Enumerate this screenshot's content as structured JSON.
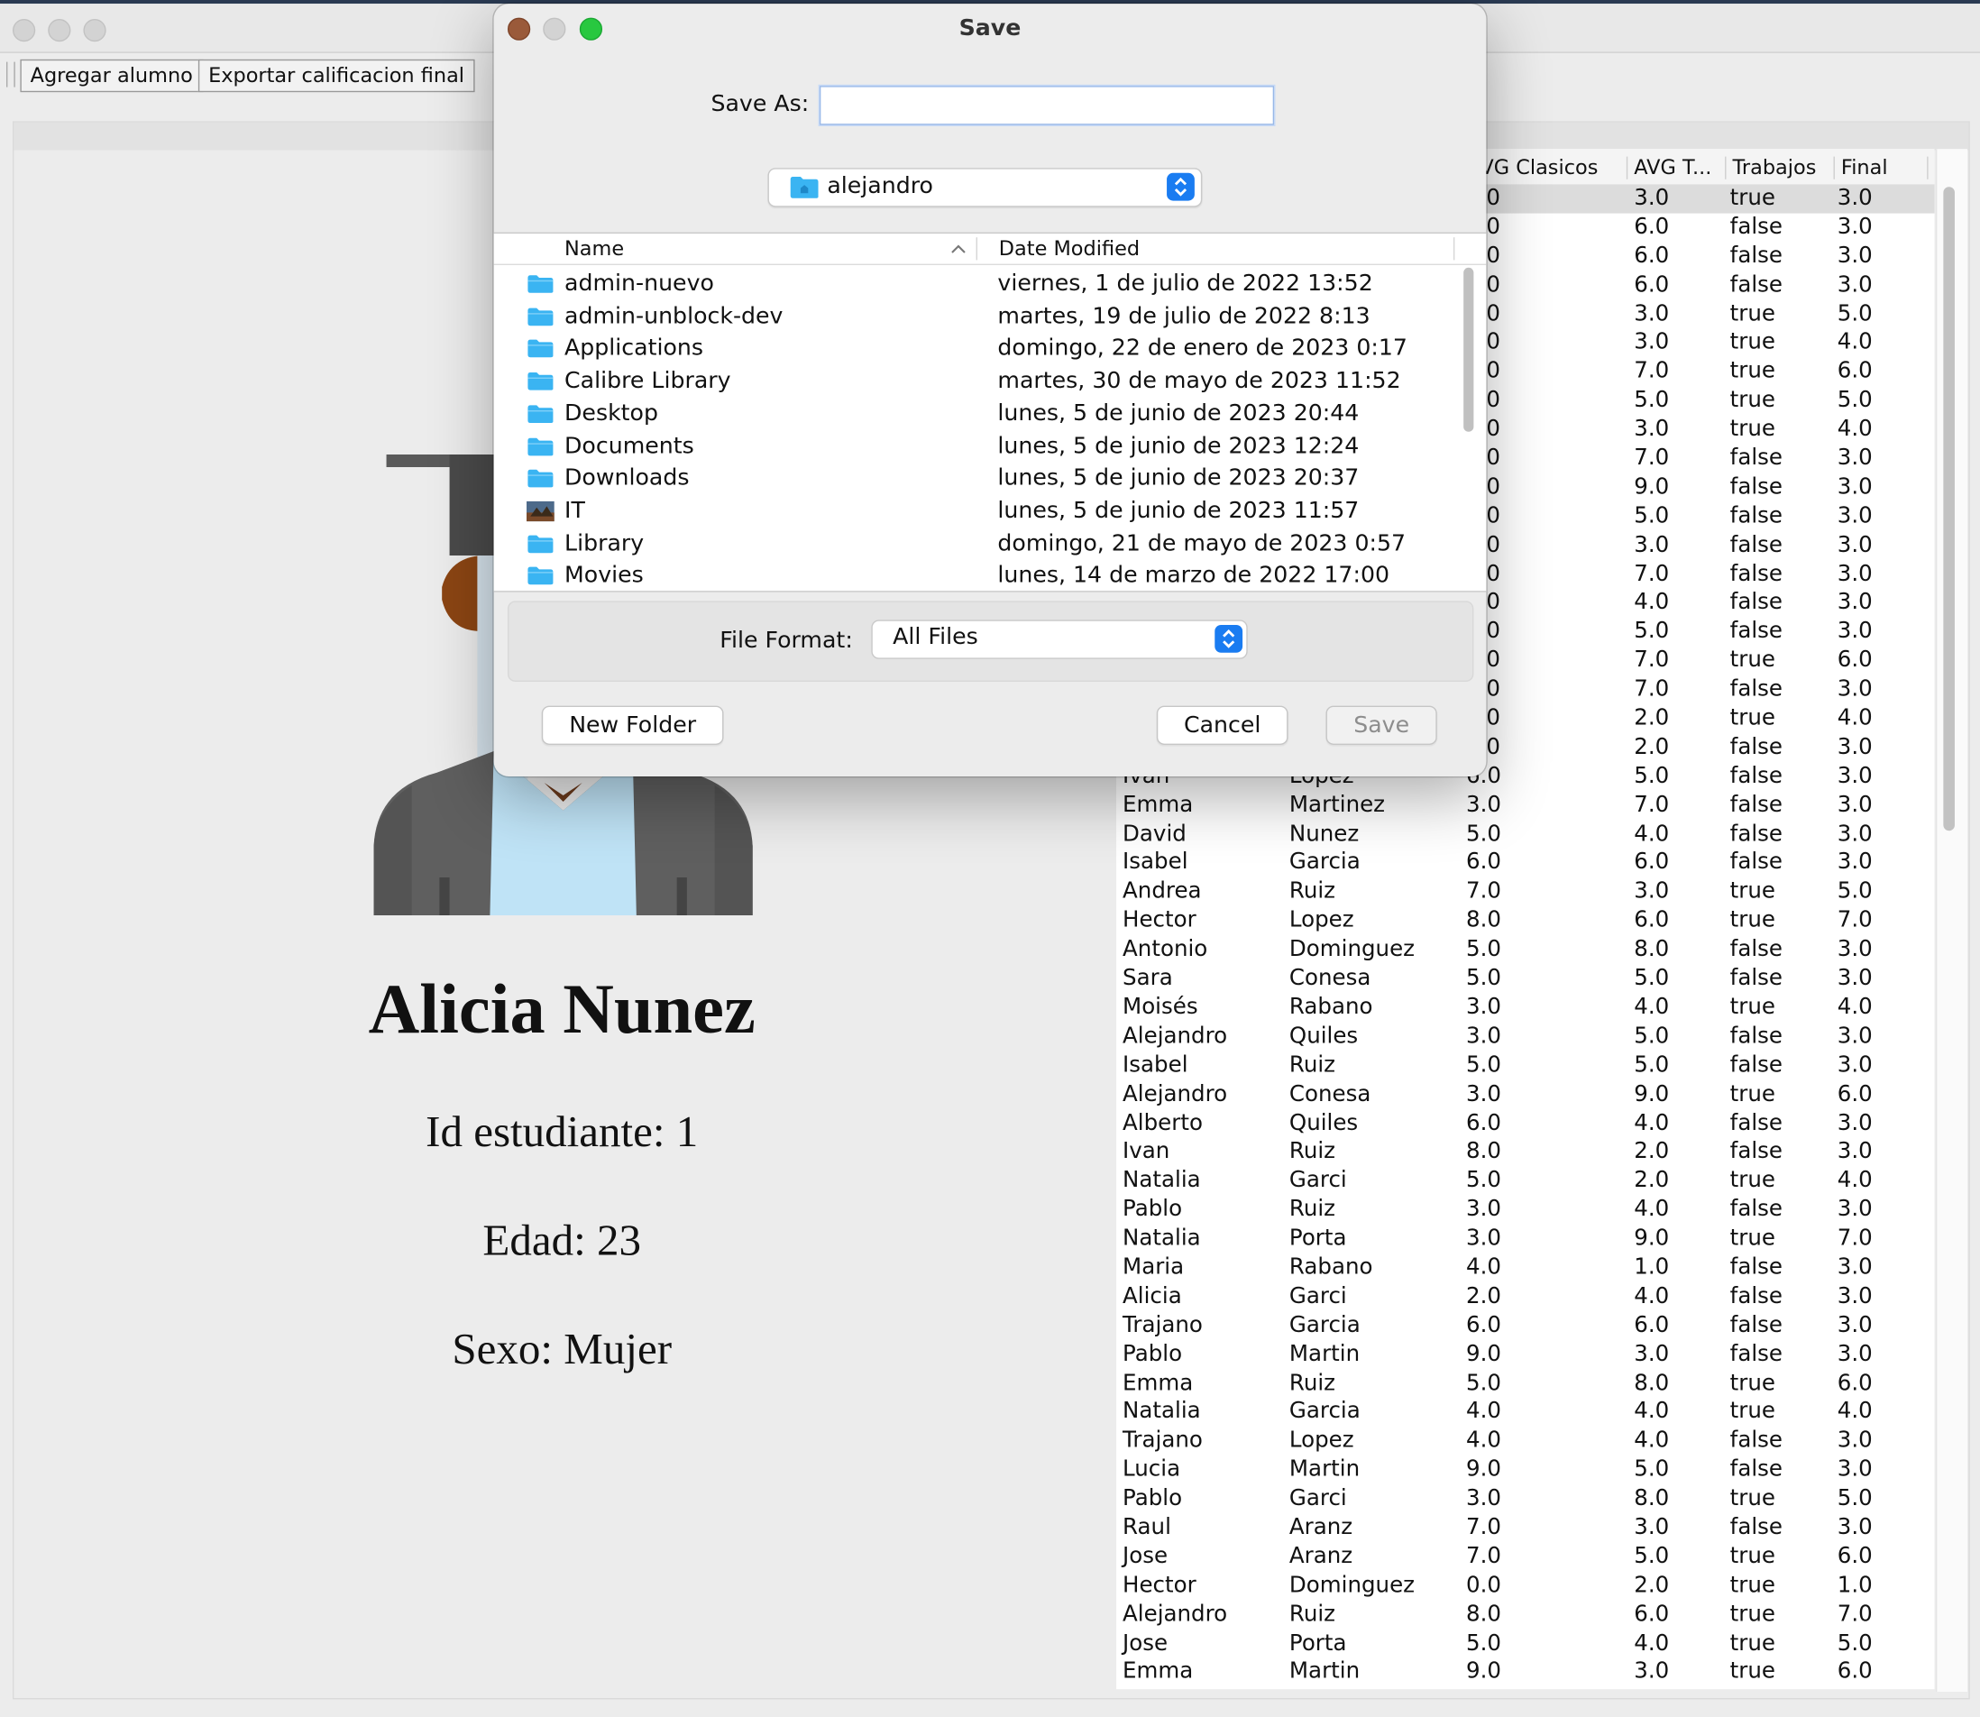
{
  "toolbar": {
    "add_student": "Agregar alumno",
    "export_final": "Exportar calificacion final"
  },
  "student": {
    "name": "Alicia Nunez",
    "id_line": "Id estudiante: 1",
    "age_line": "Edad: 23",
    "sex_line": "Sexo: Mujer"
  },
  "table": {
    "headers": [
      "VG Clasicos",
      "AVG T...",
      "Trabajos",
      "Final"
    ],
    "top_rows": [
      [
        "0",
        "3.0",
        "true",
        "3.0"
      ],
      [
        "0",
        "6.0",
        "false",
        "3.0"
      ],
      [
        "0",
        "6.0",
        "false",
        "3.0"
      ],
      [
        "0",
        "6.0",
        "false",
        "3.0"
      ],
      [
        "0",
        "3.0",
        "true",
        "5.0"
      ],
      [
        "0",
        "3.0",
        "true",
        "4.0"
      ],
      [
        "0",
        "7.0",
        "true",
        "6.0"
      ],
      [
        "0",
        "5.0",
        "true",
        "5.0"
      ],
      [
        "0",
        "3.0",
        "true",
        "4.0"
      ],
      [
        "0",
        "7.0",
        "false",
        "3.0"
      ],
      [
        "0",
        "9.0",
        "false",
        "3.0"
      ],
      [
        "0",
        "5.0",
        "false",
        "3.0"
      ],
      [
        "0",
        "3.0",
        "false",
        "3.0"
      ],
      [
        "0",
        "7.0",
        "false",
        "3.0"
      ],
      [
        "0",
        "4.0",
        "false",
        "3.0"
      ],
      [
        "0",
        "5.0",
        "false",
        "3.0"
      ],
      [
        "0",
        "7.0",
        "true",
        "6.0"
      ],
      [
        "0",
        "7.0",
        "false",
        "3.0"
      ],
      [
        "0",
        "2.0",
        "true",
        "4.0"
      ],
      [
        "0",
        "2.0",
        "false",
        "3.0"
      ]
    ],
    "rows": [
      [
        "Ivan",
        "Lopez",
        "6.0",
        "5.0",
        "false",
        "3.0"
      ],
      [
        "Emma",
        "Martinez",
        "3.0",
        "7.0",
        "false",
        "3.0"
      ],
      [
        "David",
        "Nunez",
        "5.0",
        "4.0",
        "false",
        "3.0"
      ],
      [
        "Isabel",
        "Garcia",
        "6.0",
        "6.0",
        "false",
        "3.0"
      ],
      [
        "Andrea",
        "Ruiz",
        "7.0",
        "3.0",
        "true",
        "5.0"
      ],
      [
        "Hector",
        "Lopez",
        "8.0",
        "6.0",
        "true",
        "7.0"
      ],
      [
        "Antonio",
        "Dominguez",
        "5.0",
        "8.0",
        "false",
        "3.0"
      ],
      [
        "Sara",
        "Conesa",
        "5.0",
        "5.0",
        "false",
        "3.0"
      ],
      [
        "Moisés",
        "Rabano",
        "3.0",
        "4.0",
        "true",
        "4.0"
      ],
      [
        "Alejandro",
        "Quiles",
        "3.0",
        "5.0",
        "false",
        "3.0"
      ],
      [
        "Isabel",
        "Ruiz",
        "5.0",
        "5.0",
        "false",
        "3.0"
      ],
      [
        "Alejandro",
        "Conesa",
        "3.0",
        "9.0",
        "true",
        "6.0"
      ],
      [
        "Alberto",
        "Quiles",
        "6.0",
        "4.0",
        "false",
        "3.0"
      ],
      [
        "Ivan",
        "Ruiz",
        "8.0",
        "2.0",
        "false",
        "3.0"
      ],
      [
        "Natalia",
        "Garci",
        "5.0",
        "2.0",
        "true",
        "4.0"
      ],
      [
        "Pablo",
        "Ruiz",
        "3.0",
        "4.0",
        "false",
        "3.0"
      ],
      [
        "Natalia",
        "Porta",
        "3.0",
        "9.0",
        "true",
        "7.0"
      ],
      [
        "Maria",
        "Rabano",
        "4.0",
        "1.0",
        "false",
        "3.0"
      ],
      [
        "Alicia",
        "Garci",
        "2.0",
        "4.0",
        "false",
        "3.0"
      ],
      [
        "Trajano",
        "Garcia",
        "6.0",
        "6.0",
        "false",
        "3.0"
      ],
      [
        "Pablo",
        "Martin",
        "9.0",
        "3.0",
        "false",
        "3.0"
      ],
      [
        "Emma",
        "Ruiz",
        "5.0",
        "8.0",
        "true",
        "6.0"
      ],
      [
        "Natalia",
        "Garcia",
        "4.0",
        "4.0",
        "true",
        "4.0"
      ],
      [
        "Trajano",
        "Lopez",
        "4.0",
        "4.0",
        "false",
        "3.0"
      ],
      [
        "Lucia",
        "Martin",
        "9.0",
        "5.0",
        "false",
        "3.0"
      ],
      [
        "Pablo",
        "Garci",
        "3.0",
        "8.0",
        "true",
        "5.0"
      ],
      [
        "Raul",
        "Aranz",
        "7.0",
        "3.0",
        "false",
        "3.0"
      ],
      [
        "Jose",
        "Aranz",
        "7.0",
        "5.0",
        "true",
        "6.0"
      ],
      [
        "Hector",
        "Dominguez",
        "0.0",
        "2.0",
        "true",
        "1.0"
      ],
      [
        "Alejandro",
        "Ruiz",
        "8.0",
        "6.0",
        "true",
        "7.0"
      ],
      [
        "Jose",
        "Porta",
        "5.0",
        "4.0",
        "true",
        "5.0"
      ],
      [
        "Emma",
        "Martin",
        "9.0",
        "3.0",
        "true",
        "6.0"
      ]
    ]
  },
  "dialog": {
    "title": "Save",
    "save_as_label": "Save As:",
    "save_as_value": "",
    "location": "alejandro",
    "columns": {
      "name": "Name",
      "date": "Date Modified"
    },
    "files": [
      {
        "name": "admin-nuevo",
        "date": "viernes, 1 de julio de 2022 13:52",
        "icon": "folder-icon"
      },
      {
        "name": "admin-unblock-dev",
        "date": "martes, 19 de julio de 2022 8:13",
        "icon": "folder-icon"
      },
      {
        "name": "Applications",
        "date": "domingo, 22 de enero de 2023 0:17",
        "icon": "applications-folder-icon"
      },
      {
        "name": "Calibre Library",
        "date": "martes, 30 de mayo de 2023 11:52",
        "icon": "folder-icon"
      },
      {
        "name": "Desktop",
        "date": "lunes, 5 de junio de 2023 20:44",
        "icon": "desktop-folder-icon"
      },
      {
        "name": "Documents",
        "date": "lunes, 5 de junio de 2023 12:24",
        "icon": "documents-folder-icon"
      },
      {
        "name": "Downloads",
        "date": "lunes, 5 de junio de 2023 20:37",
        "icon": "downloads-folder-icon"
      },
      {
        "name": "IT",
        "date": "lunes, 5 de junio de 2023 11:57",
        "icon": "image-file-icon"
      },
      {
        "name": "Library",
        "date": "domingo, 21 de mayo de 2023 0:57",
        "icon": "library-folder-icon"
      },
      {
        "name": "Movies",
        "date": "lunes, 14 de marzo de 2022 17:00",
        "icon": "movies-folder-icon"
      }
    ],
    "file_format_label": "File Format:",
    "file_format_value": "All Files",
    "new_folder": "New Folder",
    "cancel": "Cancel",
    "save": "Save"
  },
  "colors": {
    "accent": "#1a7cf1",
    "folder": "#3ab4f2",
    "close": "#9a5a3a",
    "zoom": "#28c840"
  }
}
